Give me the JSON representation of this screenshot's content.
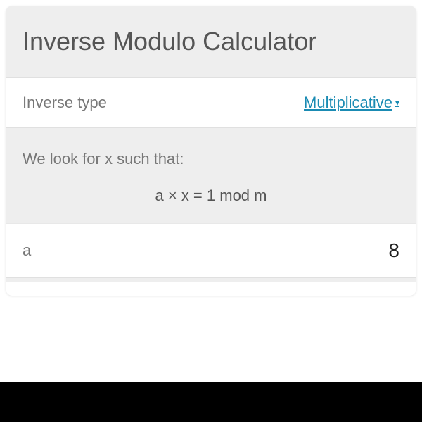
{
  "title": "Inverse Modulo Calculator",
  "inverseType": {
    "label": "Inverse type",
    "value": "Multiplicative"
  },
  "description": {
    "text": "We look for x such that:",
    "formula": "a × x = 1 mod m"
  },
  "inputs": {
    "a": {
      "label": "a",
      "value": "8"
    }
  }
}
